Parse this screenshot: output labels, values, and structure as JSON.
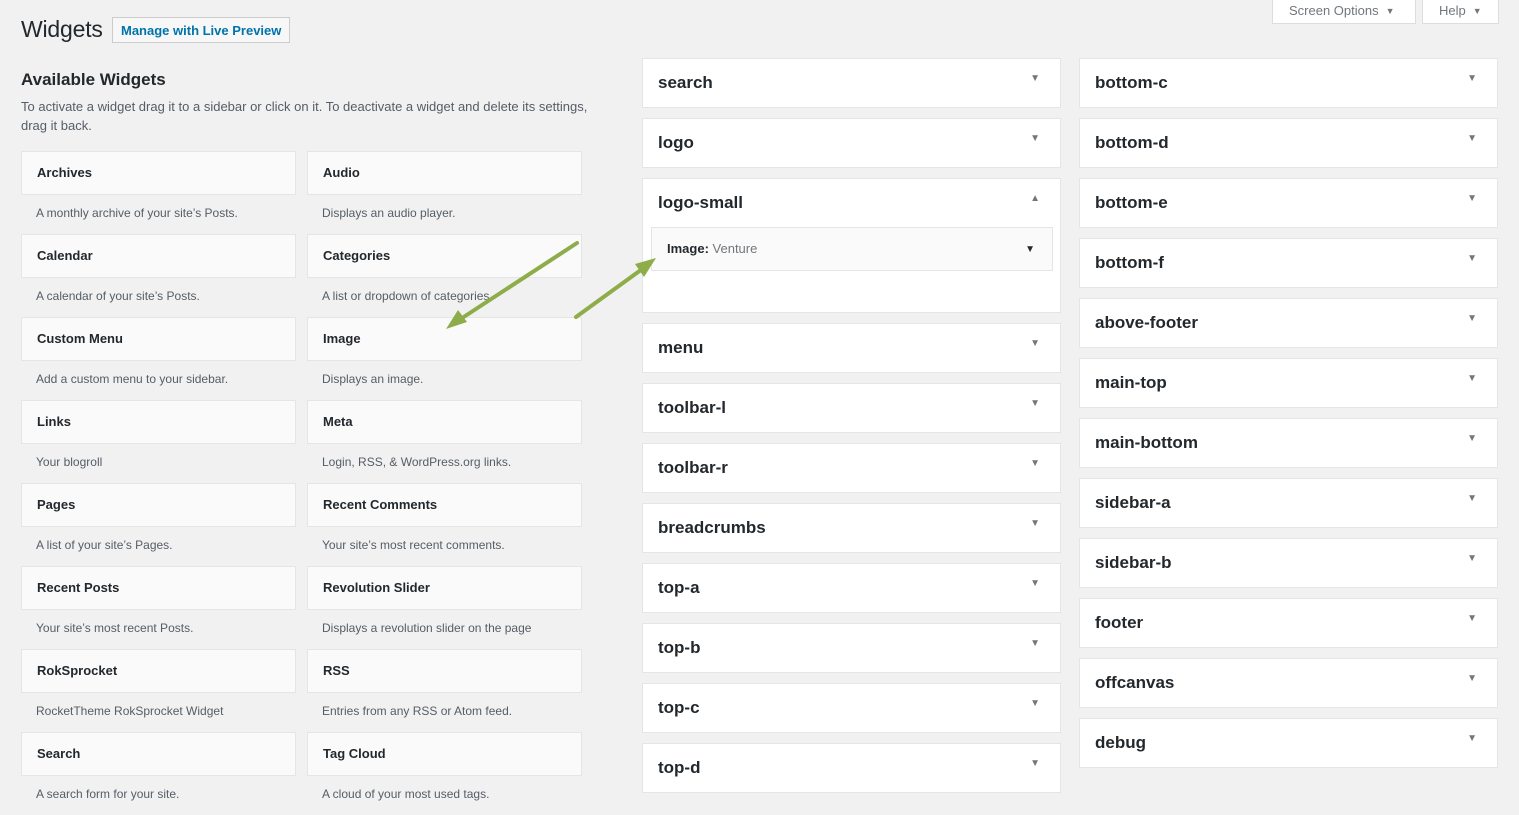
{
  "header": {
    "title": "Widgets",
    "live_preview_label": "Manage with Live Preview",
    "screen_options_label": "Screen Options",
    "help_label": "Help"
  },
  "available": {
    "title": "Available Widgets",
    "description": "To activate a widget drag it to a sidebar or click on it. To deactivate a widget and delete its settings, drag it back.",
    "widgets": [
      {
        "name": "Archives",
        "desc": "A monthly archive of your site’s Posts."
      },
      {
        "name": "Audio",
        "desc": "Displays an audio player."
      },
      {
        "name": "Calendar",
        "desc": "A calendar of your site’s Posts."
      },
      {
        "name": "Categories",
        "desc": "A list or dropdown of categories."
      },
      {
        "name": "Custom Menu",
        "desc": "Add a custom menu to your sidebar."
      },
      {
        "name": "Image",
        "desc": "Displays an image."
      },
      {
        "name": "Links",
        "desc": "Your blogroll"
      },
      {
        "name": "Meta",
        "desc": "Login, RSS, & WordPress.org links."
      },
      {
        "name": "Pages",
        "desc": "A list of your site’s Pages."
      },
      {
        "name": "Recent Comments",
        "desc": "Your site’s most recent comments."
      },
      {
        "name": "Recent Posts",
        "desc": "Your site’s most recent Posts."
      },
      {
        "name": "Revolution Slider",
        "desc": "Displays a revolution slider on the page"
      },
      {
        "name": "RokSprocket",
        "desc": "RocketTheme RokSprocket Widget"
      },
      {
        "name": "RSS",
        "desc": "Entries from any RSS or Atom feed."
      },
      {
        "name": "Search",
        "desc": "A search form for your site."
      },
      {
        "name": "Tag Cloud",
        "desc": "A cloud of your most used tags."
      }
    ]
  },
  "sidebars_left": [
    {
      "name": "search"
    },
    {
      "name": "logo"
    },
    {
      "name": "logo-small",
      "open": true,
      "widget_title": "Image:",
      "widget_subtitle": "Venture"
    },
    {
      "name": "menu"
    },
    {
      "name": "toolbar-l"
    },
    {
      "name": "toolbar-r"
    },
    {
      "name": "breadcrumbs"
    },
    {
      "name": "top-a"
    },
    {
      "name": "top-b"
    },
    {
      "name": "top-c"
    },
    {
      "name": "top-d"
    }
  ],
  "sidebars_right": [
    {
      "name": "bottom-c"
    },
    {
      "name": "bottom-d"
    },
    {
      "name": "bottom-e"
    },
    {
      "name": "bottom-f"
    },
    {
      "name": "above-footer"
    },
    {
      "name": "main-top"
    },
    {
      "name": "main-bottom"
    },
    {
      "name": "sidebar-a"
    },
    {
      "name": "sidebar-b"
    },
    {
      "name": "footer"
    },
    {
      "name": "offcanvas"
    },
    {
      "name": "debug"
    }
  ],
  "icons": {
    "caret_down": "▼",
    "caret_up": "▲",
    "arrow_color": "#8fac4a"
  }
}
